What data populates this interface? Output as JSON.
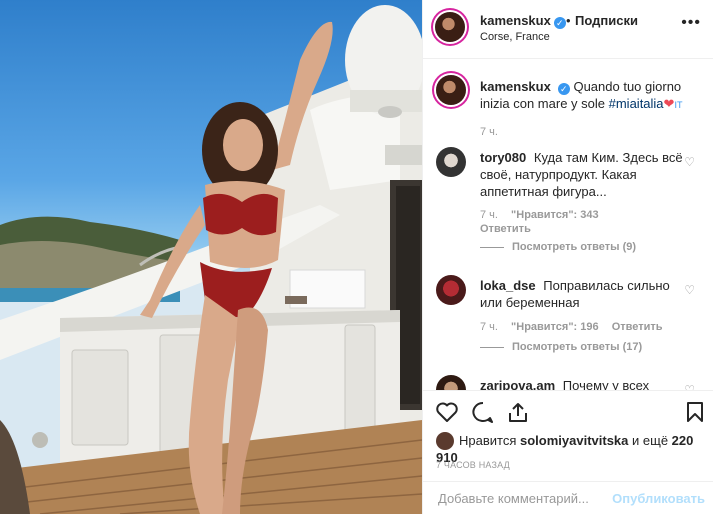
{
  "post": {
    "author": "kamenskux",
    "location": "Corse, France",
    "follow_dot": "•",
    "follow_label": "Подписки",
    "more_label": "•••",
    "caption_text": "Quando tuo giorno inizia con mare y sole",
    "caption_hashtag": "#miaitalia",
    "caption_suffix": "IT",
    "caption_time": "7 ч."
  },
  "comments": [
    {
      "user": "tory080",
      "text": "Куда там Ким. Здесь всё своё, натурпродукт. Какая аппетитная фигура...",
      "time": "7 ч.",
      "likes": "\"Нравится\": 343",
      "reply": "Ответить",
      "view_replies": "Посмотреть ответы (9)"
    },
    {
      "user": "loka_dse",
      "text": "Поправилась сильно или беременная",
      "time": "7 ч.",
      "likes": "\"Нравится\": 196",
      "reply": "Ответить",
      "view_replies": "Посмотреть ответы (17)"
    },
    {
      "user": "zaripova.am",
      "text": "Почему у всех",
      "time": "",
      "likes": "",
      "reply": "",
      "view_replies": ""
    }
  ],
  "likes_line": {
    "prefix": "Нравится",
    "user": "solomiyavitvitska",
    "suffix": "и ещё",
    "count": "220 910"
  },
  "time_ago": "7 ЧАСОВ НАЗАД",
  "add_comment": {
    "placeholder": "Добавьте комментарий...",
    "publish": "Опубликовать"
  },
  "icons": {
    "like": "heart-icon",
    "comment": "comment-icon",
    "share": "share-icon",
    "save": "bookmark-icon",
    "verified": "verified-badge-icon"
  },
  "colors": {
    "verified": "#3897f0",
    "link": "#003569",
    "publish_disabled": "#b2dffc",
    "heart_red": "#ed4956"
  }
}
